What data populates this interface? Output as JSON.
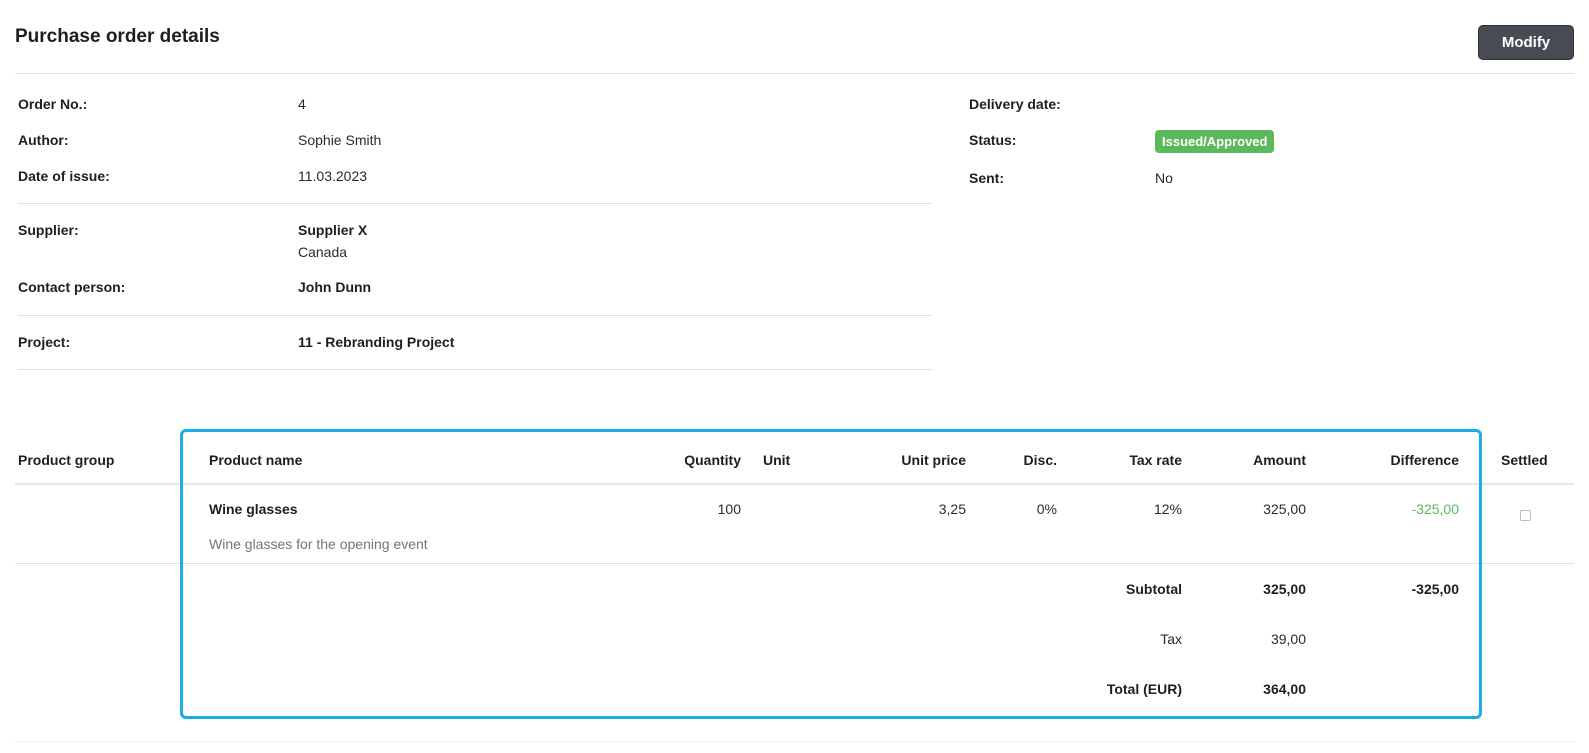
{
  "header": {
    "title": "Purchase order details",
    "modify_label": "Modify"
  },
  "info": {
    "order_no_label": "Order No.:",
    "order_no": "4",
    "author_label": "Author:",
    "author": "Sophie Smith",
    "date_label": "Date of issue:",
    "date": "11.03.2023",
    "supplier_label": "Supplier:",
    "supplier_name": "Supplier X",
    "supplier_country": "Canada",
    "contact_label": "Contact person:",
    "contact": "John Dunn",
    "project_label": "Project:",
    "project": "11 - Rebranding Project",
    "delivery_label": "Delivery date:",
    "status_label": "Status:",
    "status": "Issued/Approved",
    "sent_label": "Sent:",
    "sent": "No"
  },
  "table": {
    "headers": {
      "product_group": "Product group",
      "product_name": "Product name",
      "quantity": "Quantity",
      "unit": "Unit",
      "unit_price": "Unit price",
      "disc": "Disc.",
      "tax_rate": "Tax rate",
      "amount": "Amount",
      "difference": "Difference",
      "settled": "Settled"
    },
    "rows": [
      {
        "product_name": "Wine glasses",
        "description": "Wine glasses for the opening event",
        "quantity": "100",
        "unit_price": "3,25",
        "disc": "0%",
        "tax_rate": "12%",
        "amount": "325,00",
        "difference": "-325,00",
        "settled": false
      }
    ],
    "summary": {
      "subtotal_label": "Subtotal",
      "subtotal_amount": "325,00",
      "subtotal_difference": "-325,00",
      "tax_label": "Tax",
      "tax_amount": "39,00",
      "total_label": "Total (EUR)",
      "total_amount": "364,00"
    }
  },
  "colors": {
    "status_badge": "#5cb85c",
    "difference_text": "#5cb85c",
    "highlight_border": "#19aee6",
    "modify_button": "#474c54"
  }
}
